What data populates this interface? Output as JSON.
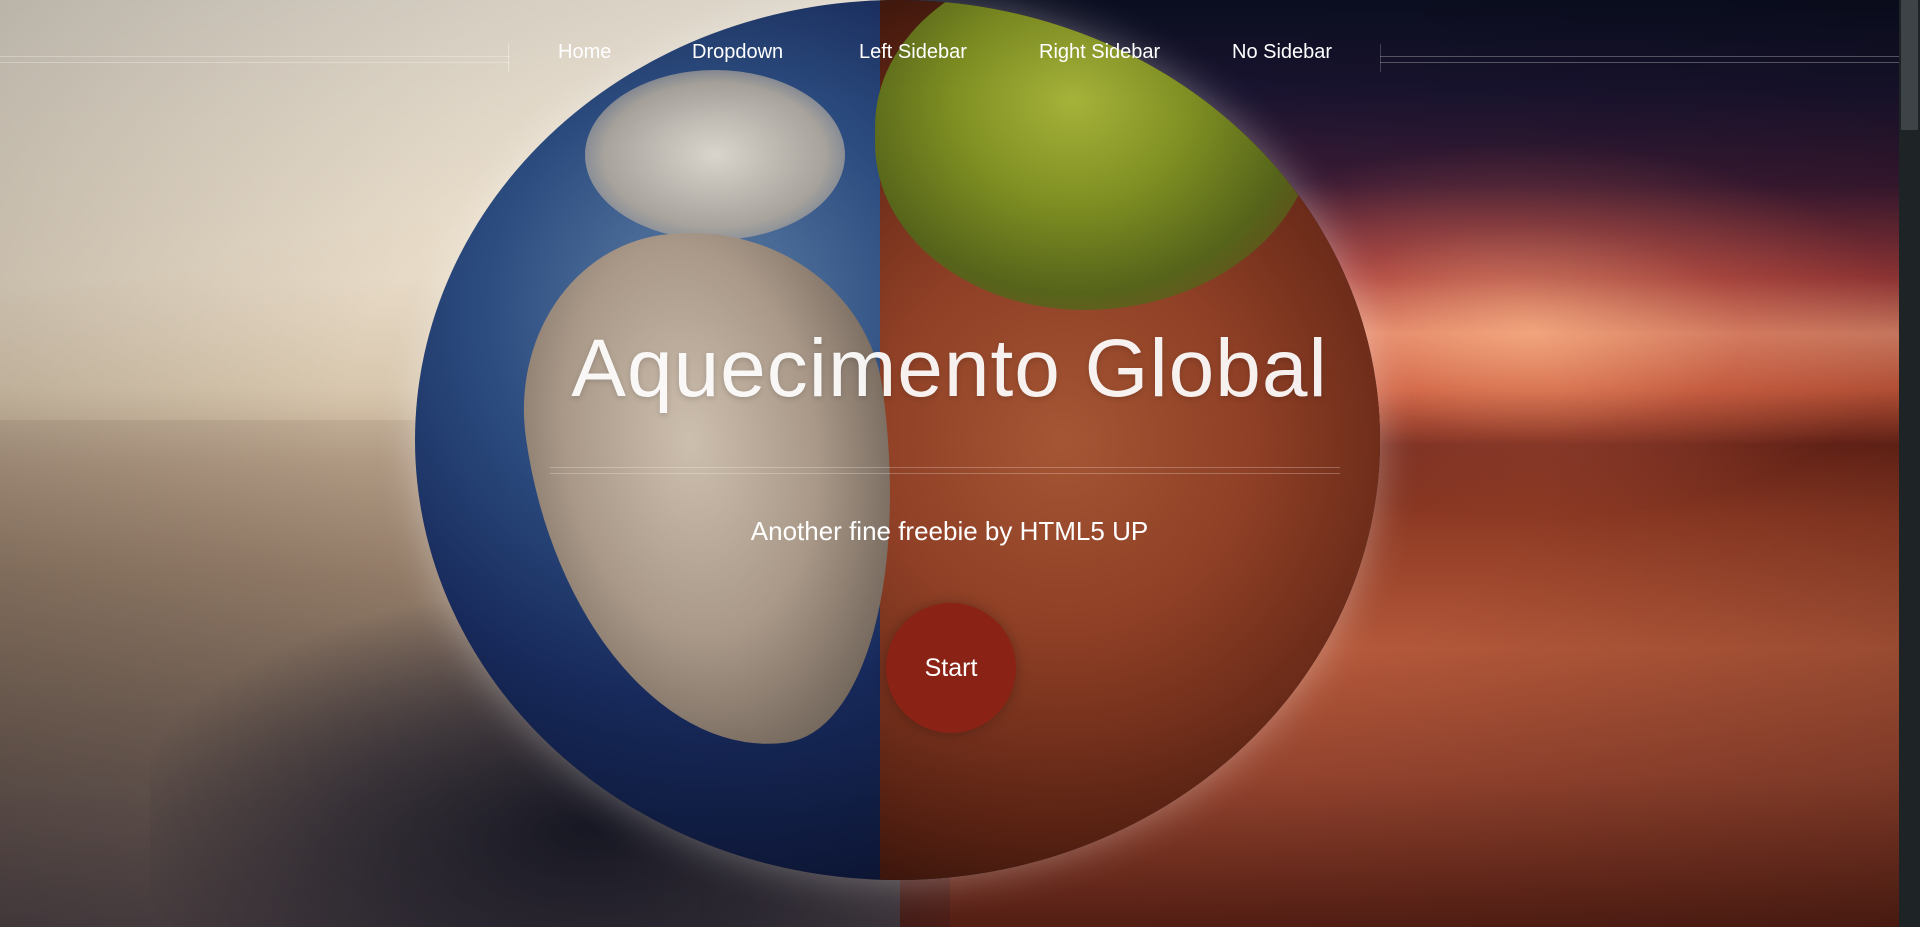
{
  "nav": {
    "items": [
      {
        "label": "Home"
      },
      {
        "label": "Dropdown"
      },
      {
        "label": "Left Sidebar"
      },
      {
        "label": "Right Sidebar"
      },
      {
        "label": "No Sidebar"
      }
    ]
  },
  "hero": {
    "title": "Aquecimento Global",
    "subtitle": "Another fine freebie by HTML5 UP",
    "button_label": "Start"
  },
  "colors": {
    "accent": "#8a2215",
    "text": "#ffffff",
    "scrollbar_track": "#1e2326",
    "scrollbar_thumb": "#3d4347"
  },
  "background_image": "earth-globe-half-green-half-scorched-desert"
}
